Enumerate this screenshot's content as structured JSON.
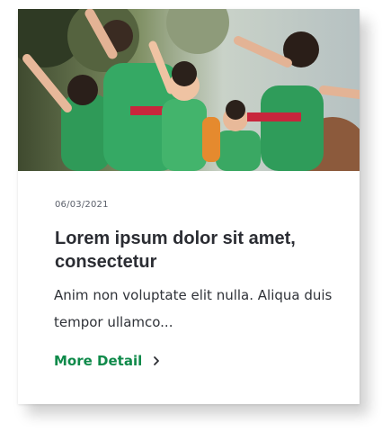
{
  "card": {
    "image_alt": "Children in green costumes dancing outdoors",
    "date": "06/03/2021",
    "title": "Lorem ipsum dolor sit amet, consectetur",
    "excerpt": "Anim non voluptate elit nulla. Aliqua duis tempor ullamco...",
    "link_label": "More Detail",
    "link_icon": "chevron-right-icon",
    "accent_color": "#0f8a4a"
  }
}
